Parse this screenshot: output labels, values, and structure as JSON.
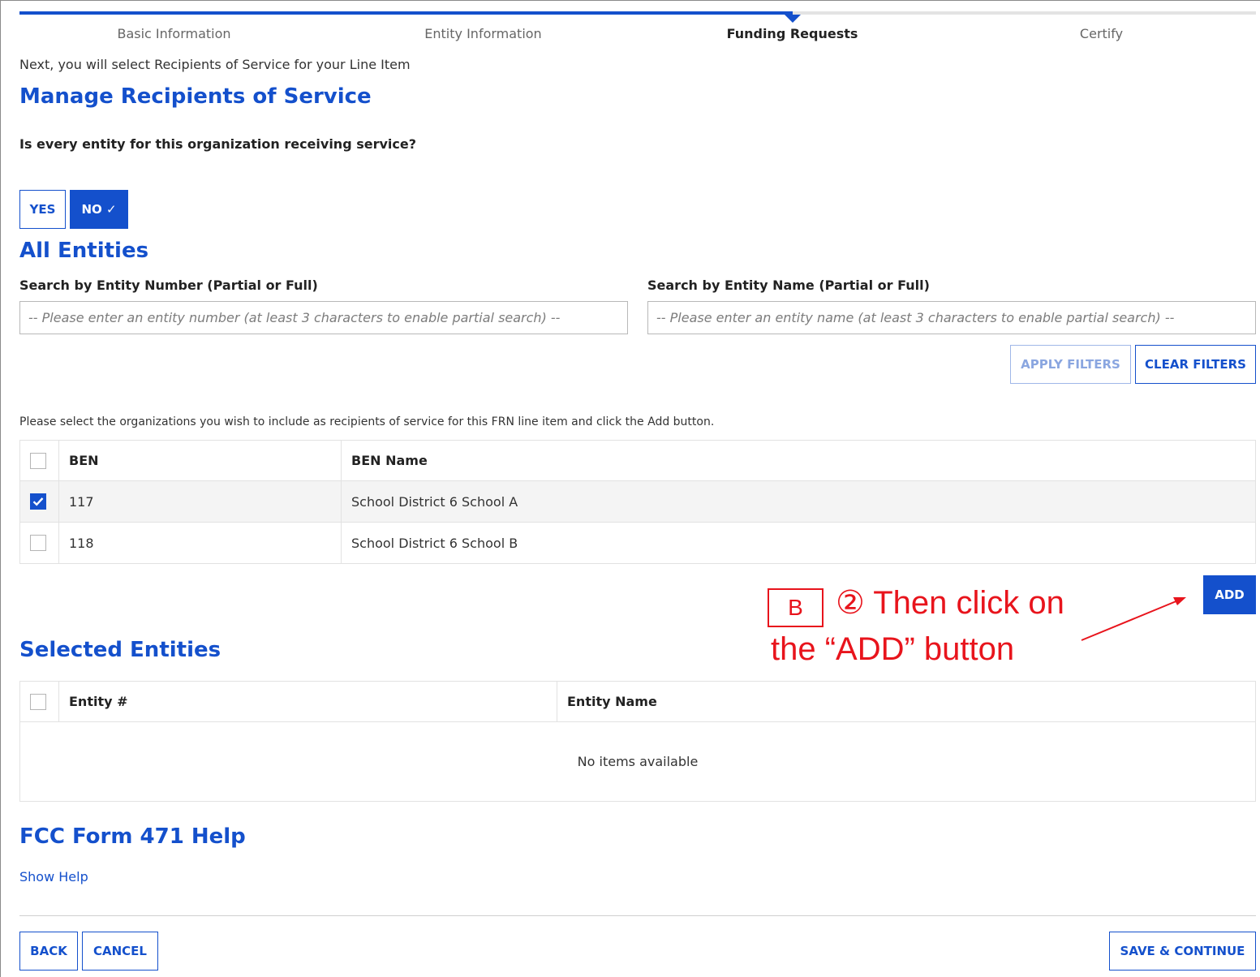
{
  "stepper": {
    "progress_percent": 62.5,
    "steps": [
      {
        "label": "Basic Information",
        "active": false
      },
      {
        "label": "Entity Information",
        "active": false
      },
      {
        "label": "Funding Requests",
        "active": true
      },
      {
        "label": "Certify",
        "active": false
      }
    ]
  },
  "intro_text": "Next, you will select Recipients of Service for your Line Item",
  "manage_title": "Manage Recipients of Service",
  "question": "Is every entity for this organization receiving service?",
  "toggle": {
    "yes_label": "YES",
    "no_label": "NO ✓",
    "selected": "NO"
  },
  "all_entities": {
    "title": "All Entities",
    "search_number_label": "Search by Entity Number (Partial or Full)",
    "search_number_placeholder": "-- Please enter an entity number (at least 3 characters to enable partial search) --",
    "search_name_label": "Search by Entity Name (Partial or Full)",
    "search_name_placeholder": "-- Please enter an entity name (at least 3 characters to enable partial search) --",
    "apply_filters_label": "APPLY FILTERS",
    "clear_filters_label": "CLEAR FILTERS",
    "instruction": "Please select the organizations you wish to include as recipients of service for this FRN line item and click the Add button.",
    "columns": [
      "BEN",
      "BEN Name"
    ],
    "rows": [
      {
        "ben": "117",
        "name": "School District 6 School A",
        "checked": true
      },
      {
        "ben": "118",
        "name": "School District 6 School B",
        "checked": false
      }
    ],
    "add_label": "ADD"
  },
  "annotation": {
    "box_letter": "B",
    "line1": "② Then click on",
    "line2": "the “ADD” button",
    "color": "#e8141c"
  },
  "selected_entities": {
    "title": "Selected Entities",
    "columns": [
      "Entity #",
      "Entity Name"
    ],
    "empty_text": "No items available"
  },
  "help": {
    "title": "FCC Form 471 Help",
    "link": "Show Help"
  },
  "footer": {
    "back_label": "BACK",
    "cancel_label": "CANCEL",
    "save_label": "SAVE & CONTINUE"
  },
  "colors": {
    "accent": "#1450cc",
    "annotation": "#e8141c"
  }
}
